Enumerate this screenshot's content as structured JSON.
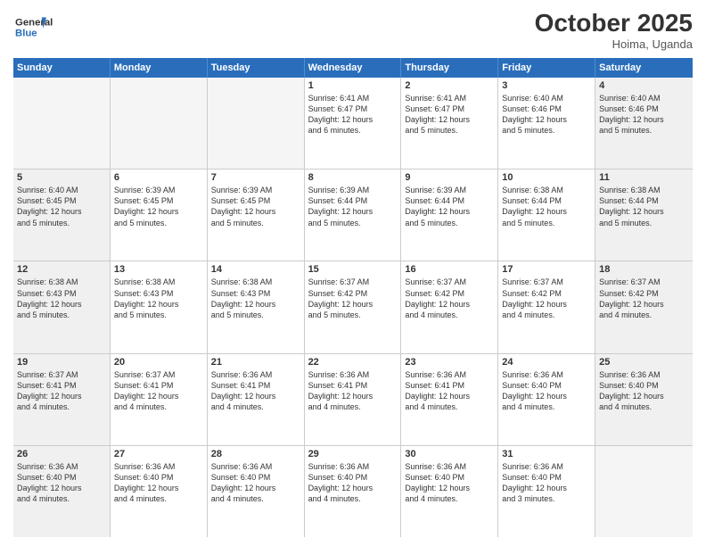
{
  "header": {
    "logo_line1": "General",
    "logo_line2": "Blue",
    "month": "October 2025",
    "location": "Hoima, Uganda"
  },
  "days_of_week": [
    "Sunday",
    "Monday",
    "Tuesday",
    "Wednesday",
    "Thursday",
    "Friday",
    "Saturday"
  ],
  "weeks": [
    [
      {
        "day": "",
        "text": "",
        "empty": true
      },
      {
        "day": "",
        "text": "",
        "empty": true
      },
      {
        "day": "",
        "text": "",
        "empty": true
      },
      {
        "day": "1",
        "text": "Sunrise: 6:41 AM\nSunset: 6:47 PM\nDaylight: 12 hours\nand 6 minutes."
      },
      {
        "day": "2",
        "text": "Sunrise: 6:41 AM\nSunset: 6:47 PM\nDaylight: 12 hours\nand 5 minutes."
      },
      {
        "day": "3",
        "text": "Sunrise: 6:40 AM\nSunset: 6:46 PM\nDaylight: 12 hours\nand 5 minutes."
      },
      {
        "day": "4",
        "text": "Sunrise: 6:40 AM\nSunset: 6:46 PM\nDaylight: 12 hours\nand 5 minutes."
      }
    ],
    [
      {
        "day": "5",
        "text": "Sunrise: 6:40 AM\nSunset: 6:45 PM\nDaylight: 12 hours\nand 5 minutes."
      },
      {
        "day": "6",
        "text": "Sunrise: 6:39 AM\nSunset: 6:45 PM\nDaylight: 12 hours\nand 5 minutes."
      },
      {
        "day": "7",
        "text": "Sunrise: 6:39 AM\nSunset: 6:45 PM\nDaylight: 12 hours\nand 5 minutes."
      },
      {
        "day": "8",
        "text": "Sunrise: 6:39 AM\nSunset: 6:44 PM\nDaylight: 12 hours\nand 5 minutes."
      },
      {
        "day": "9",
        "text": "Sunrise: 6:39 AM\nSunset: 6:44 PM\nDaylight: 12 hours\nand 5 minutes."
      },
      {
        "day": "10",
        "text": "Sunrise: 6:38 AM\nSunset: 6:44 PM\nDaylight: 12 hours\nand 5 minutes."
      },
      {
        "day": "11",
        "text": "Sunrise: 6:38 AM\nSunset: 6:44 PM\nDaylight: 12 hours\nand 5 minutes."
      }
    ],
    [
      {
        "day": "12",
        "text": "Sunrise: 6:38 AM\nSunset: 6:43 PM\nDaylight: 12 hours\nand 5 minutes."
      },
      {
        "day": "13",
        "text": "Sunrise: 6:38 AM\nSunset: 6:43 PM\nDaylight: 12 hours\nand 5 minutes."
      },
      {
        "day": "14",
        "text": "Sunrise: 6:38 AM\nSunset: 6:43 PM\nDaylight: 12 hours\nand 5 minutes."
      },
      {
        "day": "15",
        "text": "Sunrise: 6:37 AM\nSunset: 6:42 PM\nDaylight: 12 hours\nand 5 minutes."
      },
      {
        "day": "16",
        "text": "Sunrise: 6:37 AM\nSunset: 6:42 PM\nDaylight: 12 hours\nand 4 minutes."
      },
      {
        "day": "17",
        "text": "Sunrise: 6:37 AM\nSunset: 6:42 PM\nDaylight: 12 hours\nand 4 minutes."
      },
      {
        "day": "18",
        "text": "Sunrise: 6:37 AM\nSunset: 6:42 PM\nDaylight: 12 hours\nand 4 minutes."
      }
    ],
    [
      {
        "day": "19",
        "text": "Sunrise: 6:37 AM\nSunset: 6:41 PM\nDaylight: 12 hours\nand 4 minutes."
      },
      {
        "day": "20",
        "text": "Sunrise: 6:37 AM\nSunset: 6:41 PM\nDaylight: 12 hours\nand 4 minutes."
      },
      {
        "day": "21",
        "text": "Sunrise: 6:36 AM\nSunset: 6:41 PM\nDaylight: 12 hours\nand 4 minutes."
      },
      {
        "day": "22",
        "text": "Sunrise: 6:36 AM\nSunset: 6:41 PM\nDaylight: 12 hours\nand 4 minutes."
      },
      {
        "day": "23",
        "text": "Sunrise: 6:36 AM\nSunset: 6:41 PM\nDaylight: 12 hours\nand 4 minutes."
      },
      {
        "day": "24",
        "text": "Sunrise: 6:36 AM\nSunset: 6:40 PM\nDaylight: 12 hours\nand 4 minutes."
      },
      {
        "day": "25",
        "text": "Sunrise: 6:36 AM\nSunset: 6:40 PM\nDaylight: 12 hours\nand 4 minutes."
      }
    ],
    [
      {
        "day": "26",
        "text": "Sunrise: 6:36 AM\nSunset: 6:40 PM\nDaylight: 12 hours\nand 4 minutes."
      },
      {
        "day": "27",
        "text": "Sunrise: 6:36 AM\nSunset: 6:40 PM\nDaylight: 12 hours\nand 4 minutes."
      },
      {
        "day": "28",
        "text": "Sunrise: 6:36 AM\nSunset: 6:40 PM\nDaylight: 12 hours\nand 4 minutes."
      },
      {
        "day": "29",
        "text": "Sunrise: 6:36 AM\nSunset: 6:40 PM\nDaylight: 12 hours\nand 4 minutes."
      },
      {
        "day": "30",
        "text": "Sunrise: 6:36 AM\nSunset: 6:40 PM\nDaylight: 12 hours\nand 4 minutes."
      },
      {
        "day": "31",
        "text": "Sunrise: 6:36 AM\nSunset: 6:40 PM\nDaylight: 12 hours\nand 3 minutes."
      },
      {
        "day": "",
        "text": "",
        "empty": true
      }
    ]
  ]
}
